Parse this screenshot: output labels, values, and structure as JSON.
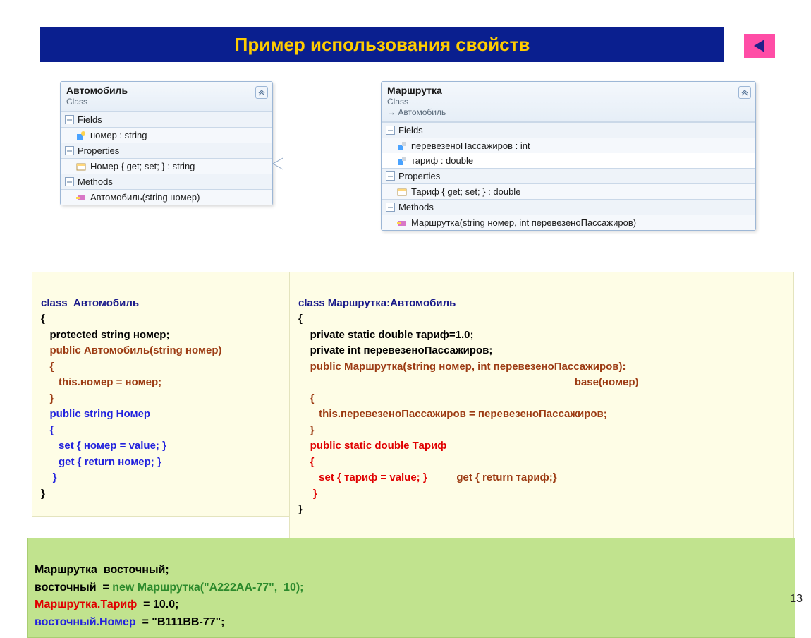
{
  "title": "Пример использования свойств",
  "page_number": "13",
  "uml_left": {
    "name": "Автомобиль",
    "stereotype": "Class",
    "sections": {
      "fields_label": "Fields",
      "fields": [
        "номер : string"
      ],
      "props_label": "Properties",
      "props": [
        "Номер { get; set; } : string"
      ],
      "methods_label": "Methods",
      "methods": [
        "Автомобиль(string номер)"
      ]
    }
  },
  "uml_right": {
    "name": "Маршрутка",
    "stereotype": "Class",
    "base": "Автомобиль",
    "sections": {
      "fields_label": "Fields",
      "fields": [
        "перевезеноПассажиров : int",
        "тариф : double"
      ],
      "props_label": "Properties",
      "props": [
        "Тариф { get; set; } : double"
      ],
      "methods_label": "Methods",
      "methods": [
        "Маршрутка(string номер, int перевезеноПассажиров)"
      ]
    }
  },
  "code_left": {
    "l1": "class  Автомобиль",
    "l2": "{",
    "l3": "   protected string номер;",
    "l4a": "   public",
    "l4b": " Автомобиль(string номер)",
    "l5": "   {",
    "l6": "      this.номер = номер;",
    "l7": "   }",
    "l8a": "   public string",
    "l8b": " Номер",
    "l9": "   {",
    "l10": "      set { номер = value; }",
    "l11": "      get { return номер; }",
    "l12": "    }",
    "l13": "}"
  },
  "code_right": {
    "l1": "class Маршрутка:Автомобиль",
    "l2": "{",
    "l3": "    private static double тариф=1.0;",
    "l4": "    private int перевезеноПассажиров;",
    "l5a": "    public",
    "l5b": " Маршрутка(string номер, int перевезеноПассажиров):",
    "l6": "                                                                                              base(номер)",
    "l7": "    {",
    "l8": "       this.перевезеноПассажиров = перевезеноПассажиров;",
    "l9": "    }",
    "l10a": "    public static double",
    "l10b": " Тариф",
    "l11": "    {",
    "l12a": "       set { тариф = value; }",
    "l12b": "          get { return тариф;}",
    "l13": "     }",
    "l14": "}"
  },
  "usage": {
    "l1": "Маршрутка  восточный;",
    "l2a": "восточный  = ",
    "l2b": "new",
    "l2c": " Маршрутка(\"А222АА-77\",  10);",
    "l3a": "Маршрутка.Тариф",
    "l3b": "  = 10.0;",
    "l4a": "восточный.Номер",
    "l4b": "  = \"В111ВВ-77\";"
  }
}
